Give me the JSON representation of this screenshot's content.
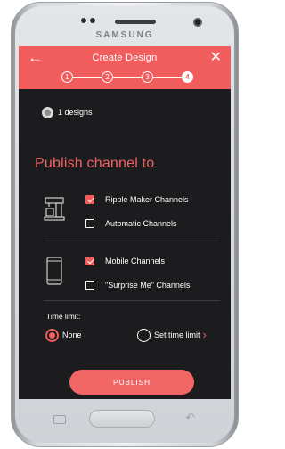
{
  "device": {
    "brand": "SAMSUNG"
  },
  "header": {
    "title": "Create Design",
    "back_icon": "arrow-left-icon",
    "close_icon": "close-icon",
    "steps": [
      "1",
      "2",
      "3",
      "4"
    ],
    "active_step": "4"
  },
  "designs": {
    "label": "1 designs",
    "icon": "design-thumbnail-icon"
  },
  "section_title": "Publish channel to",
  "channel_groups": [
    {
      "icon": "ripple-maker-device-icon",
      "options": [
        {
          "label": "Ripple Maker Channels",
          "checked": true
        },
        {
          "label": "Automatic Channels",
          "checked": false
        }
      ]
    },
    {
      "icon": "mobile-device-icon",
      "options": [
        {
          "label": "Mobile Channels",
          "checked": true
        },
        {
          "label": "\"Surprise Me\" Channels",
          "checked": false
        }
      ]
    }
  ],
  "time_limit": {
    "label": "Time limit:",
    "options": [
      {
        "label": "None",
        "selected": true
      },
      {
        "label": "Set time limit",
        "selected": false
      }
    ]
  },
  "publish_button": {
    "label": "PUBLISH"
  },
  "colors": {
    "accent": "#f15c5c",
    "background": "#1c1c1e",
    "text": "#ffffff"
  }
}
